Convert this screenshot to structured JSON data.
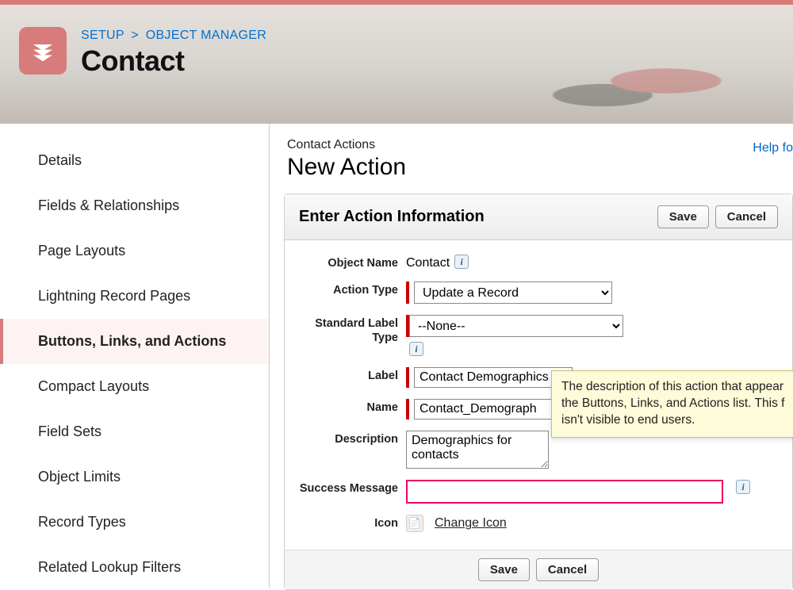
{
  "breadcrumb": {
    "root": "SETUP",
    "leaf": "OBJECT MANAGER"
  },
  "page_title": "Contact",
  "sidebar": {
    "items": [
      {
        "label": "Details",
        "active": false
      },
      {
        "label": "Fields & Relationships",
        "active": false
      },
      {
        "label": "Page Layouts",
        "active": false
      },
      {
        "label": "Lightning Record Pages",
        "active": false
      },
      {
        "label": "Buttons, Links, and Actions",
        "active": true
      },
      {
        "label": "Compact Layouts",
        "active": false
      },
      {
        "label": "Field Sets",
        "active": false
      },
      {
        "label": "Object Limits",
        "active": false
      },
      {
        "label": "Record Types",
        "active": false
      },
      {
        "label": "Related Lookup Filters",
        "active": false
      }
    ]
  },
  "content": {
    "subhead": "Contact Actions",
    "head": "New Action",
    "help_link": "Help fo",
    "panel_title": "Enter Action Information",
    "save_label": "Save",
    "cancel_label": "Cancel"
  },
  "form": {
    "object_name": {
      "label": "Object Name",
      "value": "Contact"
    },
    "action_type": {
      "label": "Action Type",
      "value": "Update a Record"
    },
    "standard_label_type": {
      "label": "Standard Label Type",
      "value": "--None--"
    },
    "label_field": {
      "label": "Label",
      "value": "Contact Demographics"
    },
    "name_field": {
      "label": "Name",
      "value": "Contact_Demograph"
    },
    "description": {
      "label": "Description",
      "value": "Demographics for contacts"
    },
    "success_message": {
      "label": "Success Message",
      "value": ""
    },
    "icon": {
      "label": "Icon",
      "change_link": "Change Icon"
    }
  },
  "tooltip": "The description of this action that appear the Buttons, Links, and Actions list. This f isn't visible to end users."
}
